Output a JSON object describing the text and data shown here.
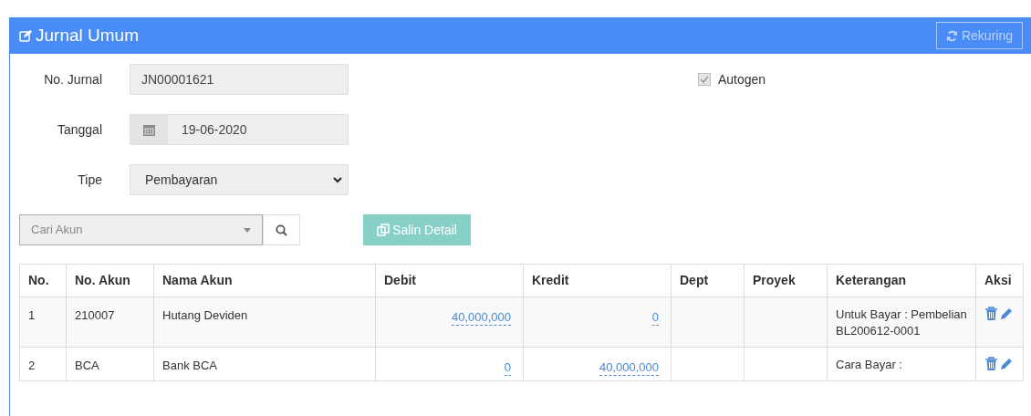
{
  "header": {
    "title": "Jurnal Umum",
    "rekuring_button": {
      "label": "Rekuring",
      "disabled": true
    }
  },
  "form": {
    "no_jurnal": {
      "label": "No. Jurnal",
      "value": "JN00001621"
    },
    "tanggal": {
      "label": "Tanggal",
      "value": "19-06-2020"
    },
    "tipe": {
      "label": "Tipe",
      "value": "Pembayaran"
    },
    "autogen": {
      "label": "Autogen",
      "checked": true,
      "disabled": true
    }
  },
  "search": {
    "placeholder": "Cari Akun"
  },
  "salin_button": {
    "label": "Salin Detail",
    "disabled": true
  },
  "table": {
    "columns": [
      "No.",
      "No. Akun",
      "Nama Akun",
      "Debit",
      "Kredit",
      "Dept",
      "Proyek",
      "Keterangan",
      "Aksi"
    ],
    "rows": [
      {
        "no": "1",
        "no_akun": "210007",
        "nama_akun": "Hutang Deviden",
        "debit": "40,000,000",
        "kredit": "0",
        "dept": "",
        "proyek": "",
        "keterangan": "Untuk Bayar : Pembelian BL200612-0001"
      },
      {
        "no": "2",
        "no_akun": "BCA",
        "nama_akun": "Bank BCA",
        "debit": "0",
        "kredit": "40,000,000",
        "dept": "",
        "proyek": "",
        "keterangan": "Cara Bayar :"
      }
    ]
  }
}
